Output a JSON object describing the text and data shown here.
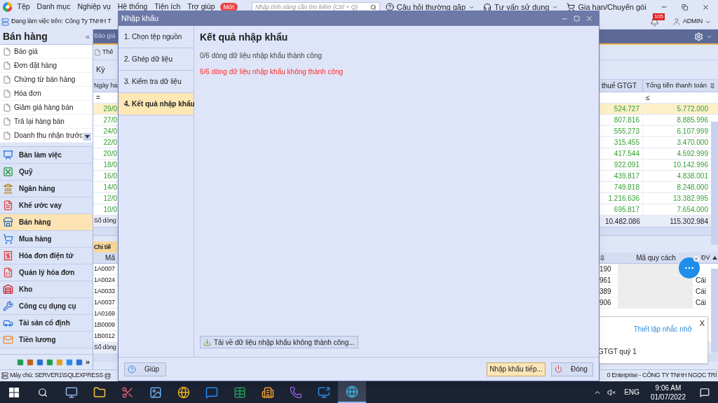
{
  "menu_bar": {
    "items": [
      "Tệp",
      "Danh mục",
      "Nghiệp vụ",
      "Hệ thống",
      "Tiện ích",
      "Trợ giúp"
    ],
    "new_badge": "Mới",
    "search": {
      "placeholder": "Nhập tính năng cần tìm kiếm (Ctrl + Q)"
    },
    "links": [
      "Câu hỏi thường gặp",
      "Tư vấn sử dụng",
      "Gia hạn/Chuyển gói"
    ]
  },
  "work_bar": {
    "label": "Đang làm việc trên:",
    "company": "Công Ty TNHH T",
    "notification_count": "105",
    "user": "ADMIN"
  },
  "sidebar": {
    "title": "Bán hàng",
    "collapse": "«",
    "documents": [
      "Báo giá",
      "Đơn đặt hàng",
      "Chứng từ bán hàng",
      "Hóa đơn",
      "Giảm giá hàng bán",
      "Trả lại hàng bán",
      "Doanh thu nhận trước"
    ],
    "modules": [
      {
        "label": "Bàn làm việc",
        "kind": "chart",
        "selected": false
      },
      {
        "label": "Quỹ",
        "kind": "safe",
        "selected": false
      },
      {
        "label": "Ngân hàng",
        "kind": "bank",
        "selected": false
      },
      {
        "label": "Khế ước vay",
        "kind": "contract",
        "selected": false
      },
      {
        "label": "Bán hàng",
        "kind": "store",
        "selected": true
      },
      {
        "label": "Mua hàng",
        "kind": "cart",
        "selected": false
      },
      {
        "label": "Hóa đơn điện tử",
        "kind": "invoice",
        "selected": false
      },
      {
        "label": "Quản lý hóa đơn",
        "kind": "invoice_list",
        "selected": false
      },
      {
        "label": "Kho",
        "kind": "warehouse",
        "selected": false
      },
      {
        "label": "Công cụ dụng cụ",
        "kind": "tools",
        "selected": false
      },
      {
        "label": "Tài sản cố định",
        "kind": "car",
        "selected": false
      },
      {
        "label": "Tiền lương",
        "kind": "payroll",
        "selected": false
      }
    ],
    "more": "»"
  },
  "background": {
    "tab": "Báo giá",
    "toolbar_fragment": "Thê",
    "period_fragment": "Kỳ",
    "columns": {
      "left": "Ngày ha",
      "vat": "thuế GTGT",
      "total": "Tổng tiền thanh toán"
    },
    "filter": {
      "left": "=",
      "total": "≤"
    },
    "rows": [
      {
        "date": "29/0",
        "vat": "524.727",
        "total": "5.772.000",
        "selected": true
      },
      {
        "date": "27/0",
        "vat": "807.816",
        "total": "8.885.996",
        "selected": false
      },
      {
        "date": "24/0",
        "vat": "555.273",
        "total": "6.107.999",
        "selected": false
      },
      {
        "date": "22/0",
        "vat": "315.455",
        "total": "3.470.000",
        "selected": false
      },
      {
        "date": "20/0",
        "vat": "417.544",
        "total": "4.592.999",
        "selected": false
      },
      {
        "date": "18/0",
        "vat": "922.091",
        "total": "10.142.996",
        "selected": false
      },
      {
        "date": "16/0",
        "vat": "439.817",
        "total": "4.838.001",
        "selected": false
      },
      {
        "date": "14/0",
        "vat": "749.818",
        "total": "8.248.000",
        "selected": false
      },
      {
        "date": "12/0",
        "vat": "1.216.636",
        "total": "13.382.995",
        "selected": false
      },
      {
        "date": "10/0",
        "vat": "695.817",
        "total": "7.654.000",
        "selected": false
      }
    ],
    "totals": {
      "label": "Số dòng",
      "vat": "10.482.086",
      "total": "115.302.984"
    },
    "detail": {
      "tab": "Chi tiế",
      "left_column": "Mã",
      "right_column": "Mã quy cách",
      "unit_column": "ĐV",
      "codes": [
        "1A0007",
        "1A0024",
        "1A0033",
        "1A0037",
        "1A0169",
        "1B0009",
        "1B0012"
      ],
      "right_rows": [
        {
          "code": "190"
        },
        {
          "code": "961",
          "unit": "Cái"
        },
        {
          "code": "389",
          "unit": "Cái"
        },
        {
          "code": "906",
          "unit": "Cái"
        }
      ],
      "totals_label": "Số dòng"
    }
  },
  "reminder": {
    "close": "X",
    "link": "Thiết lập nhắc nhở",
    "text": "GTGT quý 1"
  },
  "dialog": {
    "title": "Nhập khẩu",
    "steps": [
      {
        "label": "1. Chọn tệp nguồn",
        "selected": false
      },
      {
        "label": "2. Ghép dữ liệu",
        "selected": false
      },
      {
        "label": "3. Kiểm tra dữ liệu",
        "selected": false
      },
      {
        "label": "4. Kết quả nhập khẩu",
        "selected": true
      }
    ],
    "heading": "Kết quả nhập khẩu",
    "results": [
      {
        "kind": "success",
        "text": "0/6 dòng dữ liệu nhập khẩu thành công"
      },
      {
        "kind": "failure",
        "text": "6/6 dòng dữ liệu nhập khẩu không thành công"
      }
    ],
    "download_button": "Tải về dữ liệu nhập khẩu không thành công...",
    "help_button": "Giúp",
    "continue_button": "Nhập khẩu tiếp...",
    "close_button": "Đóng"
  },
  "status_bar": {
    "server": "Máy chủ: SERVER1\\SQLEXPRESS",
    "product": "0 Enterprise - CÔNG TY TNHH NGỌC TRÍ"
  },
  "taskbar": {
    "apps": [
      {
        "kind": "computer",
        "selected": false
      },
      {
        "kind": "folder",
        "selected": false
      },
      {
        "kind": "tool",
        "selected": false
      },
      {
        "kind": "photos",
        "selected": false
      },
      {
        "kind": "browser",
        "selected": false
      },
      {
        "kind": "chat",
        "selected": false
      },
      {
        "kind": "sheet",
        "selected": false
      },
      {
        "kind": "stripe",
        "selected": false
      },
      {
        "kind": "phone",
        "selected": false
      },
      {
        "kind": "remote",
        "selected": false
      },
      {
        "kind": "app",
        "selected": true
      }
    ],
    "language": "ENG",
    "time": "9:06 AM",
    "date": "01/07/2022"
  }
}
